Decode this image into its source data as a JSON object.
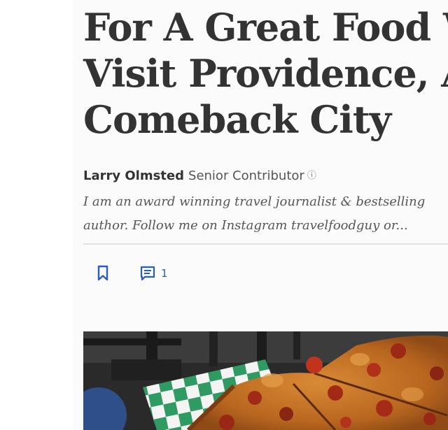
{
  "headline": {
    "lines": [
      "For A Great Food W",
      "Visit Providence, Ar",
      "Comeback City"
    ]
  },
  "byline": {
    "author": "Larry Olmsted",
    "role": "Senior Contributor"
  },
  "bio": {
    "lines": [
      "I am an award winning travel journalist & bestselling",
      "author. Follow me on Instagram travelfoodguy or..."
    ]
  },
  "actions": {
    "comment_count": "1"
  },
  "colors": {
    "accent": "#2b5dbf",
    "headline": "#333333"
  },
  "icons": {
    "save": "bookmark-icon",
    "comments": "comment-icon",
    "info": "info-icon"
  }
}
